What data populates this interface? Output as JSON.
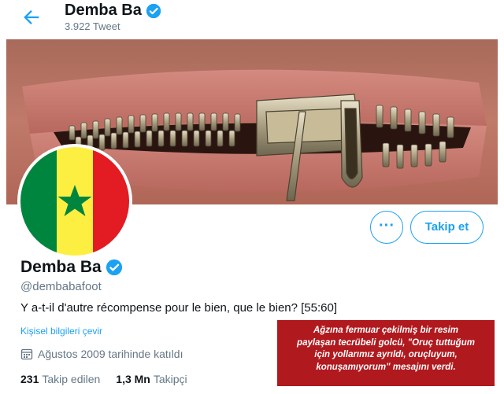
{
  "header": {
    "name": "Demba Ba",
    "tweet_count": "3.922 Tweet"
  },
  "profile": {
    "name": "Demba Ba",
    "handle": "@dembabafoot",
    "bio": "Y a-t-il d'autre récompense pour le bien, que le bien? [55:60]",
    "translate_label": "Kişisel bilgileri çevir",
    "joined": "Ağustos 2009 tarihinde katıldı",
    "following_count": "231",
    "following_label": "Takip edilen",
    "followers_count": "1,3 Mn",
    "followers_label": "Takipçi"
  },
  "actions": {
    "more_label": "···",
    "follow_label": "Takip et"
  },
  "caption": {
    "lines": [
      "Ağzına fermuar çekilmiş bir resim",
      "paylaşan tecrübeli golcü, \"Oruç tuttuğum",
      "için yollarımız ayrıldı, oruçluyum,",
      "konuşamıyorum\" mesajını verdi."
    ]
  },
  "colors": {
    "accent": "#1da1f2",
    "caption_bg": "#b0191e",
    "senegal_green": "#00853f",
    "senegal_yellow": "#fdef42",
    "senegal_red": "#e31b23"
  }
}
